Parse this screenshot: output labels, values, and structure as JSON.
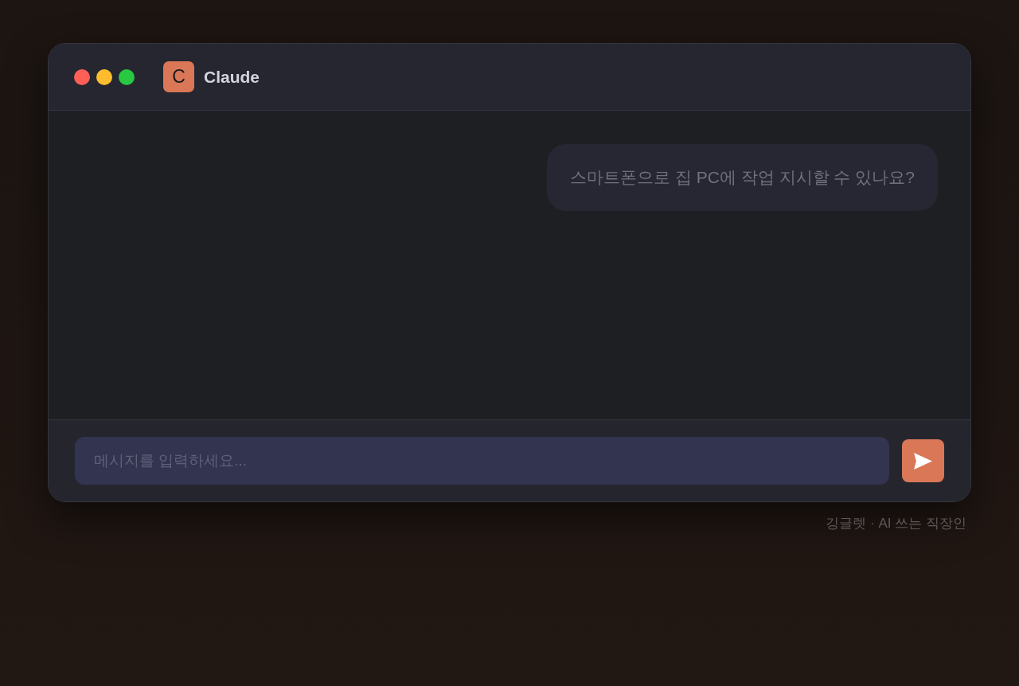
{
  "window": {
    "title": "Claude",
    "logo_letter": "C"
  },
  "messages": [
    {
      "kind": "sent",
      "text": "스마트폰으로 집 PC에 작업 지시할 수 있나요?"
    }
  ],
  "composer": {
    "placeholder": "메시지를 입력하세요..."
  },
  "footer": "깅글렛 · AI 쓰는 직장인"
}
